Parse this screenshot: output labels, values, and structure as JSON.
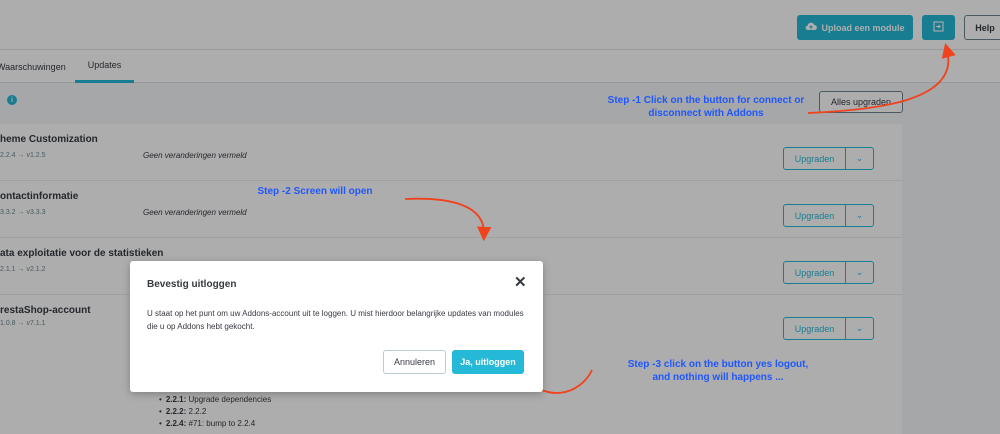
{
  "toolbar": {
    "upload_label": "Upload een module",
    "help_label": "Help"
  },
  "tabs": [
    {
      "label": "Waarschuwingen"
    },
    {
      "label": "Updates"
    }
  ],
  "updates": {
    "info_icon": "i",
    "upgrade_all_label": "Alles upgraden",
    "modules": [
      {
        "name": "heme Customization",
        "version": "2.2.4 → v1.2.5",
        "note": "Geen veranderingen vermeld",
        "upgrade_label": "Upgraden"
      },
      {
        "name": "ontactinformatie",
        "version": "3.3.2 → v3.3.3",
        "note": "Geen veranderingen vermeld",
        "upgrade_label": "Upgraden"
      },
      {
        "name": "ata exploitatie voor de statistieken",
        "version": "2.1.1 → v2.1.2",
        "note": "",
        "upgrade_label": "Upgraden"
      },
      {
        "name": "restaShop-account",
        "version": "1.0.8 → v7.1.1",
        "note": "",
        "upgrade_label": "Upgraden"
      }
    ],
    "changelog": [
      {
        "version": "2.2.1:",
        "text": " Upgrade dependencies"
      },
      {
        "version": "2.2.2:",
        "text": " 2.2.2"
      },
      {
        "version": "2.2.4:",
        "text": " #71: bump to 2.2.4"
      }
    ]
  },
  "modal": {
    "title": "Bevestig uitloggen",
    "close_symbol": "✕",
    "body": "U staat op het punt om uw Addons-account uit te loggen. U mist hierdoor belangrijke updates van modules die u op Addons hebt gekocht.",
    "cancel_label": "Annuleren",
    "confirm_label": "Ja, uitloggen"
  },
  "annotations": {
    "step1": "Step -1 Click on the button for connect or\ndisconnect with Addons",
    "step2": "Step -2 Screen will open",
    "step3": "Step -3  click on the button yes logout,\nand nothing will happens ..."
  },
  "colors": {
    "accent": "#25b9d7",
    "annotation_text": "#1f57ff",
    "annotation_arrow": "#f0421c"
  }
}
